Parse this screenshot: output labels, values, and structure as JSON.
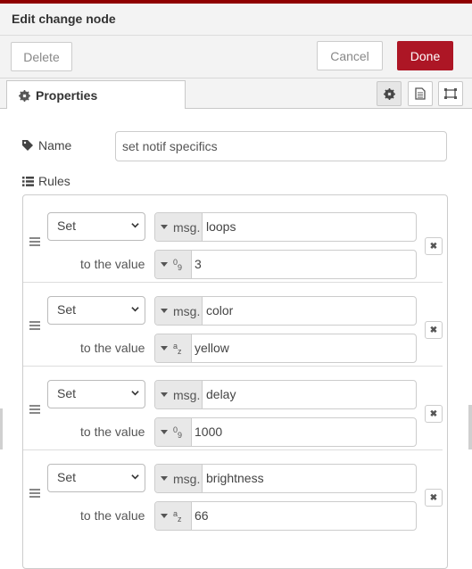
{
  "dialog": {
    "title": "Edit change node",
    "delete_label": "Delete",
    "cancel_label": "Cancel",
    "done_label": "Done",
    "accent_color": "#ad1625"
  },
  "tabs": {
    "properties_label": "Properties",
    "icons": [
      "gear-icon",
      "description-icon",
      "appearance-icon"
    ]
  },
  "form": {
    "name_label": "Name",
    "name_value": "set notif specifics",
    "rules_label": "Rules",
    "to_value_label": "to the value",
    "action": "Set",
    "msg_prefix": "msg.",
    "rules": [
      {
        "property": "loops",
        "value": "3",
        "value_type": "number"
      },
      {
        "property": "color",
        "value": "yellow",
        "value_type": "string"
      },
      {
        "property": "delay",
        "value": "1000",
        "value_type": "number"
      },
      {
        "property": "brightness",
        "value": "66",
        "value_type": "string"
      }
    ]
  }
}
